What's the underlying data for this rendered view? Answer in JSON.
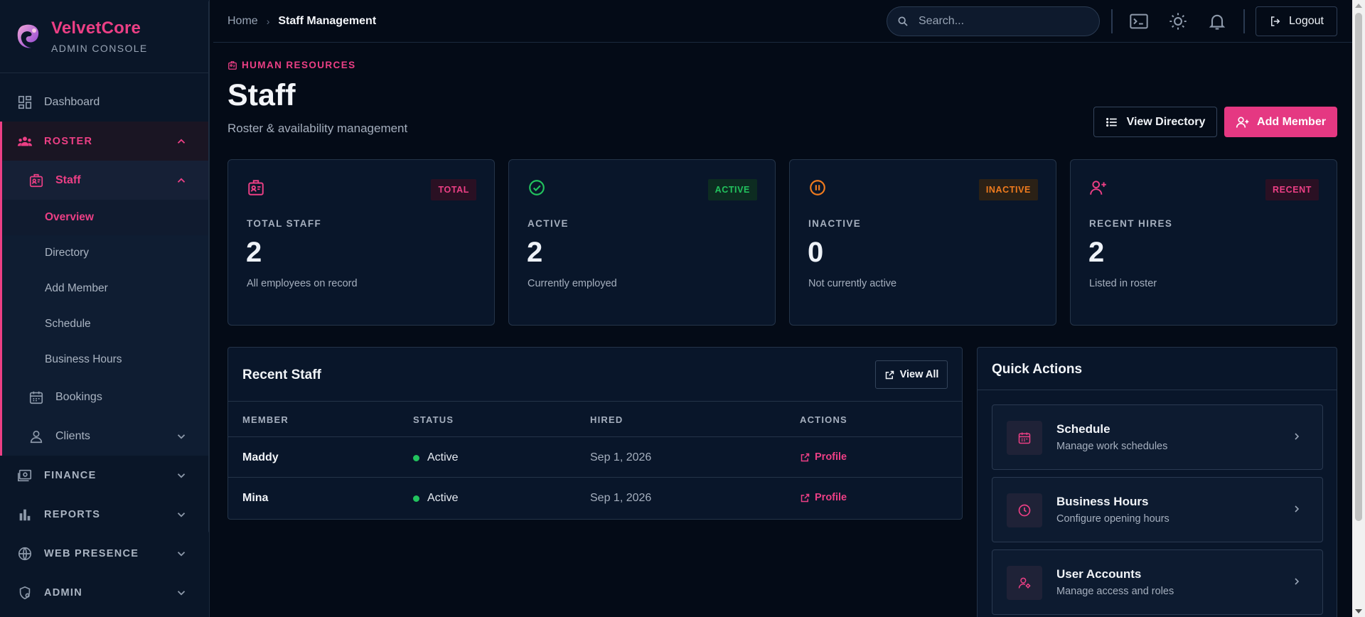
{
  "brand": {
    "name": "VelvetCore",
    "subtitle": "ADMIN CONSOLE"
  },
  "sidebar": {
    "dashboard": "Dashboard",
    "roster": "ROSTER",
    "staff": "Staff",
    "staff_items": [
      "Overview",
      "Directory",
      "Add Member",
      "Schedule",
      "Business Hours"
    ],
    "bookings": "Bookings",
    "clients": "Clients",
    "finance": "FINANCE",
    "reports": "REPORTS",
    "web_presence": "WEB PRESENCE",
    "admin": "ADMIN"
  },
  "topbar": {
    "breadcrumb_home": "Home",
    "breadcrumb_current": "Staff Management",
    "search_placeholder": "Search...",
    "logout": "Logout"
  },
  "header": {
    "eyebrow": "HUMAN RESOURCES",
    "title": "Staff",
    "subtitle": "Roster & availability management",
    "view_directory": "View Directory",
    "add_member": "Add Member"
  },
  "stats": [
    {
      "badge": "TOTAL",
      "label": "TOTAL STAFF",
      "value": "2",
      "desc": "All employees on record"
    },
    {
      "badge": "ACTIVE",
      "label": "ACTIVE",
      "value": "2",
      "desc": "Currently employed"
    },
    {
      "badge": "INACTIVE",
      "label": "INACTIVE",
      "value": "0",
      "desc": "Not currently active"
    },
    {
      "badge": "RECENT",
      "label": "RECENT HIRES",
      "value": "2",
      "desc": "Listed in roster"
    }
  ],
  "recent_staff": {
    "title": "Recent Staff",
    "view_all": "View All",
    "columns": [
      "MEMBER",
      "STATUS",
      "HIRED",
      "ACTIONS"
    ],
    "rows": [
      {
        "member": "Maddy",
        "status": "Active",
        "hired": "Sep 1, 2026",
        "action": "Profile"
      },
      {
        "member": "Mina",
        "status": "Active",
        "hired": "Sep 1, 2026",
        "action": "Profile"
      }
    ]
  },
  "quick_actions": {
    "title": "Quick Actions",
    "items": [
      {
        "title": "Schedule",
        "desc": "Manage work schedules",
        "icon": "calendar-icon"
      },
      {
        "title": "Business Hours",
        "desc": "Configure opening hours",
        "icon": "clock-icon"
      },
      {
        "title": "User Accounts",
        "desc": "Manage access and roles",
        "icon": "user-cog-icon"
      }
    ]
  },
  "colors": {
    "accent": "#ec3f85",
    "background": "#040b17",
    "success": "#22c35e",
    "warning": "#f07b1e"
  }
}
